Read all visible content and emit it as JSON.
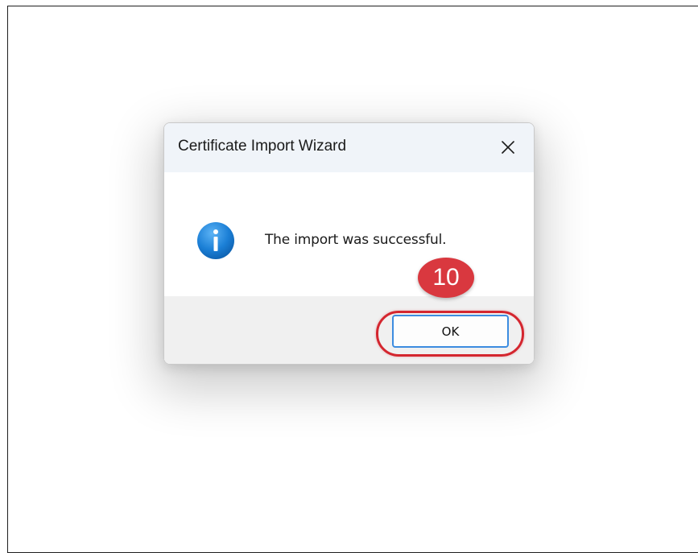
{
  "dialog": {
    "title": "Certificate Import Wizard",
    "close_icon": "close-icon",
    "info_icon": "info-icon",
    "message": "The import was successful.",
    "ok_label": "OK"
  },
  "annotation": {
    "step_number": "10",
    "highlight_color": "#d4262f",
    "badge_color": "#d9383f"
  },
  "colors": {
    "titlebar_bg": "#f0f4f9",
    "footer_bg": "#f0f0f0",
    "button_border": "#3c8ce0",
    "info_icon_blue": "#1b7fd6"
  }
}
